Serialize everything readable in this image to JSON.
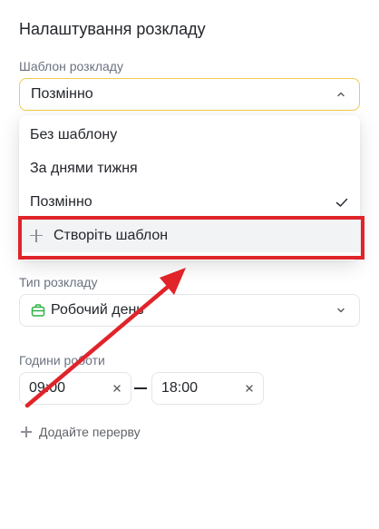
{
  "title": "Налаштування розкладу",
  "template_field": {
    "label": "Шаблон розкладу",
    "value": "Позмінно"
  },
  "template_options": [
    {
      "label": "Без шаблону",
      "selected": false
    },
    {
      "label": "За днями тижня",
      "selected": false
    },
    {
      "label": "Позмінно",
      "selected": true
    }
  ],
  "create_template": {
    "label": "Створіть шаблон",
    "icon": "plus-icon"
  },
  "schedule_type": {
    "label": "Тип розкладу",
    "value": "Робочий день",
    "icon": "briefcase-icon"
  },
  "work_hours": {
    "label": "Години роботи",
    "start": "09:00",
    "end": "18:00"
  },
  "add_break": {
    "label": "Додайте перерву",
    "icon": "plus-icon"
  },
  "colors": {
    "highlight": "#e0242a",
    "focus_border": "#f2c94c",
    "briefcase": "#2fb344"
  }
}
